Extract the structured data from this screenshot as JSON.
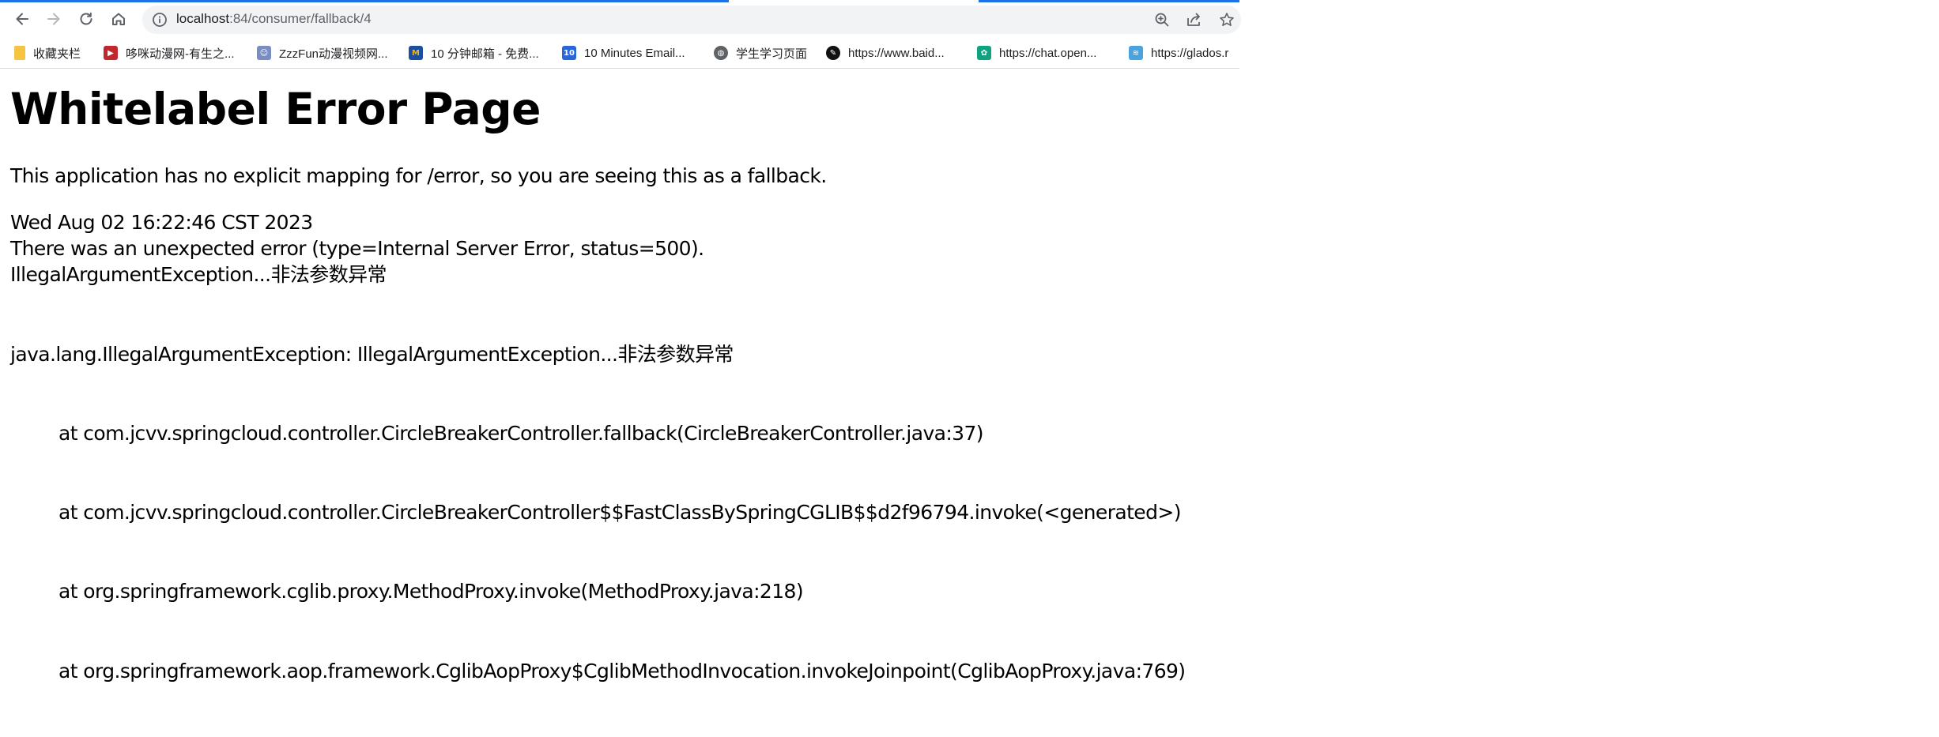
{
  "browser": {
    "url_host": "localhost",
    "url_rest": ":84/consumer/fallback/4",
    "nav_icons": [
      "back-icon",
      "forward-icon",
      "reload-icon",
      "home-icon"
    ],
    "omnibox_icons": [
      "site-info-icon",
      "zoom-icon",
      "share-icon",
      "bookmark-star-icon"
    ]
  },
  "bookmarks": [
    {
      "label": "收藏夹栏",
      "icon": "folder-icon",
      "color": "#f6c443"
    },
    {
      "label": "哆咪动漫网-有生之...",
      "icon": "tv-icon",
      "color": "#c0282e"
    },
    {
      "label": "ZzzFun动漫视频网...",
      "icon": "anime-site-icon",
      "color": "#7a8cc4"
    },
    {
      "label": "10 分钟邮箱 - 免费...",
      "icon": "mail-site-icon",
      "color": "#1c4fa0"
    },
    {
      "label": "10 Minutes Email...",
      "icon": "ten-minutes-icon",
      "color": "#2b66d9"
    },
    {
      "label": "学生学习页面",
      "icon": "globe-icon",
      "color": "#5f6368"
    },
    {
      "label": "https://www.baid...",
      "icon": "baidu-icon",
      "color": "#111111"
    },
    {
      "label": "https://chat.open...",
      "icon": "openai-icon",
      "color": "#10a37f"
    },
    {
      "label": "https://glados.r",
      "icon": "glados-icon",
      "color": "#4aa3df"
    }
  ],
  "page": {
    "title": "Whitelabel Error Page",
    "message": "This application has no explicit mapping for /error, so you are seeing this as a fallback.",
    "timestamp": "Wed Aug 02 16:22:46 CST 2023",
    "error_line": "There was an unexpected error (type=Internal Server Error, status=500).",
    "exception_message": "IllegalArgumentException...非法参数异常",
    "stack_trace": [
      "java.lang.IllegalArgumentException: IllegalArgumentException...非法参数异常",
      "at com.jcvv.springcloud.controller.CircleBreakerController.fallback(CircleBreakerController.java:37)",
      "at com.jcvv.springcloud.controller.CircleBreakerController$$FastClassBySpringCGLIB$$d2f96794.invoke(<generated>)",
      "at org.springframework.cglib.proxy.MethodProxy.invoke(MethodProxy.java:218)",
      "at org.springframework.aop.framework.CglibAopProxy$CglibMethodInvocation.invokeJoinpoint(CglibAopProxy.java:769)"
    ]
  }
}
